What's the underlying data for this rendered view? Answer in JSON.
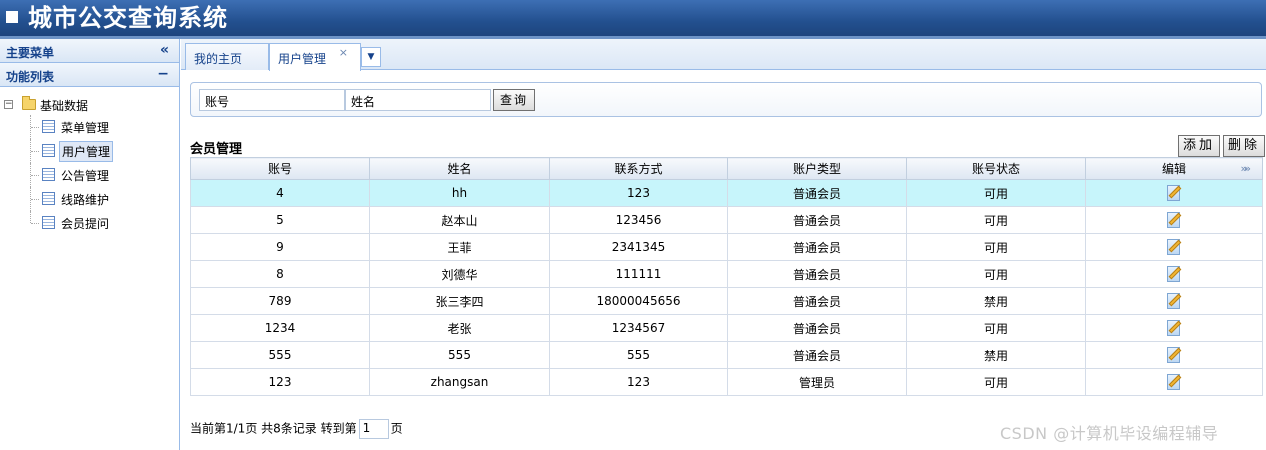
{
  "app": {
    "title": "城市公交查询系统"
  },
  "sidebar": {
    "main_menu_label": "主要菜单",
    "collapse_glyph": "«",
    "function_list_label": "功能列表",
    "minimize_glyph": "−",
    "root": {
      "label": "基础数据",
      "toggle": "−"
    },
    "items": [
      {
        "label": "菜单管理"
      },
      {
        "label": "用户管理",
        "active": true
      },
      {
        "label": "公告管理"
      },
      {
        "label": "线路维护"
      },
      {
        "label": "会员提问"
      }
    ]
  },
  "tabs": {
    "home": "我的主页",
    "user": "用户管理",
    "close_glyph": "×",
    "menu_glyph": "▼"
  },
  "search": {
    "account_value": "账号",
    "name_value": "姓名",
    "query_label": "查询"
  },
  "grid": {
    "title": "会员管理",
    "add_label": "添加",
    "delete_label": "删除",
    "columns": [
      "账号",
      "姓名",
      "联系方式",
      "账户类型",
      "账号状态",
      "编辑"
    ],
    "more_glyph": "»»",
    "rows": [
      [
        "4",
        "hh",
        "123",
        "普通会员",
        "可用"
      ],
      [
        "5",
        "赵本山",
        "123456",
        "普通会员",
        "可用"
      ],
      [
        "9",
        "王菲",
        "2341345",
        "普通会员",
        "可用"
      ],
      [
        "8",
        "刘德华",
        "111111",
        "普通会员",
        "可用"
      ],
      [
        "789",
        "张三李四",
        "18000045656",
        "普通会员",
        "禁用"
      ],
      [
        "1234",
        "老张",
        "1234567",
        "普通会员",
        "可用"
      ],
      [
        "555",
        "555",
        "555",
        "普通会员",
        "禁用"
      ],
      [
        "123",
        "zhangsan",
        "123",
        "管理员",
        "可用"
      ]
    ]
  },
  "pager": {
    "info": "当前第1/1页 共8条记录 转到第",
    "goto_value": "1",
    "suffix": "页"
  },
  "watermark": "CSDN @计算机毕设编程辅导"
}
